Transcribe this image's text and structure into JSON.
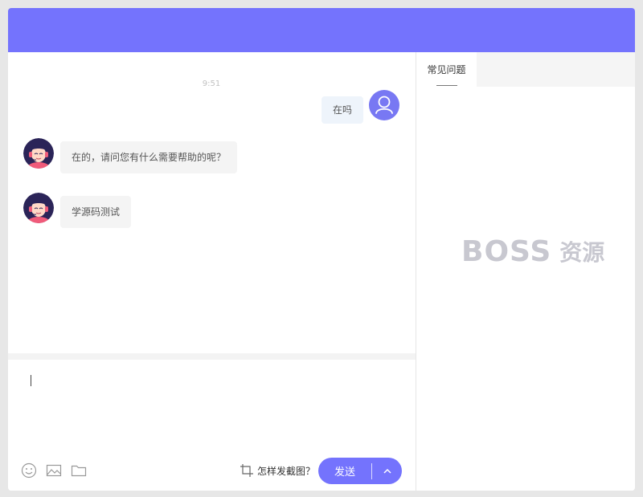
{
  "chat": {
    "time": "9:51",
    "messages": [
      {
        "from": "user",
        "text": "在吗"
      },
      {
        "from": "agent",
        "text": "在的，请问您有什么需要帮助的呢？"
      },
      {
        "from": "agent",
        "text": "学源码测试"
      }
    ]
  },
  "composer": {
    "icons": [
      "emoji-icon",
      "image-icon",
      "folder-icon"
    ],
    "screenshot_help": "怎样发截图？",
    "send_label": "发送"
  },
  "sidebar": {
    "tabs": [
      {
        "label": "常见问题",
        "active": true
      }
    ]
  },
  "watermark": {
    "latin": "BOSS",
    "cjk": "资源"
  },
  "colors": {
    "accent": "#7473fd",
    "user_bubble": "#eef4fb",
    "agent_bubble": "#f4f4f4"
  }
}
